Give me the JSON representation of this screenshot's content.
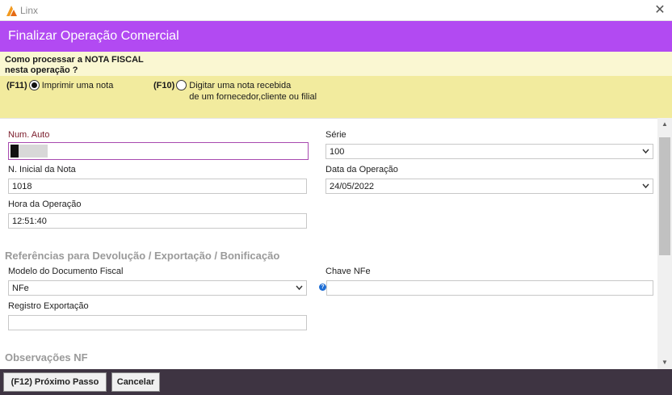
{
  "window": {
    "app_title": "Linx",
    "close_glyph": "✕"
  },
  "header": {
    "title": "Finalizar Operação Comercial",
    "color": "#b24af2"
  },
  "prompt": {
    "question": "Como processar a NOTA FISCAL nesta operação ?"
  },
  "options": [
    {
      "key": "(F11)",
      "label": "Imprimir uma nota",
      "selected": true
    },
    {
      "key": "(F10)",
      "label_line1": "Digitar uma nota recebida",
      "label_line2": "de um fornecedor,cliente ou filial",
      "selected": false
    }
  ],
  "form": {
    "num_auto": {
      "label": "Num. Auto",
      "value": ""
    },
    "serie": {
      "label": "Série",
      "value": "100"
    },
    "n_inicial": {
      "label": "N. Inicial da Nota",
      "value": "1018"
    },
    "data_operacao": {
      "label": "Data da Operação",
      "value": "24/05/2022"
    },
    "hora_operacao": {
      "label": "Hora da Operação",
      "value": "12:51:40"
    },
    "section_referencias": "Referências para Devolução / Exportação / Bonificação",
    "modelo_documento": {
      "label": "Modelo do Documento Fiscal",
      "value": "NFe"
    },
    "chave_nfe": {
      "label": "Chave NFe",
      "value": ""
    },
    "registro_exportacao": {
      "label": "Registro Exportação",
      "value": ""
    },
    "section_observacoes": "Observações NF"
  },
  "footer": {
    "next_label": "(F12) Próximo Passo",
    "cancel_label": "Cancelar"
  },
  "icons": {
    "logo": "linx-logo-icon",
    "help": "help-icon",
    "dropdown": "chevron-down-icon"
  }
}
